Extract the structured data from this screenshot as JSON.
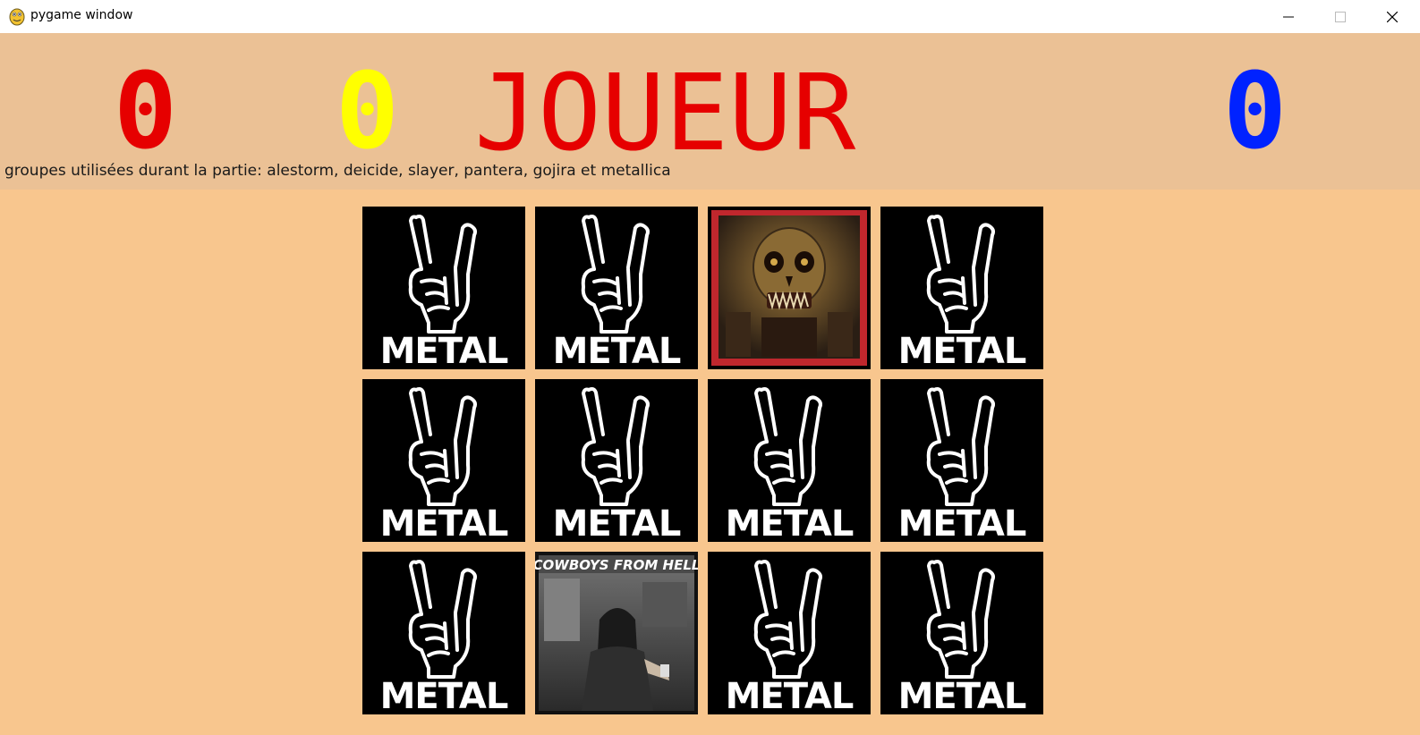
{
  "window": {
    "title": "pygame window",
    "icon": "snake-icon",
    "controls": [
      "minimize-icon",
      "maximize-icon",
      "close-icon"
    ]
  },
  "header": {
    "scores": [
      {
        "player": "red",
        "value": "0",
        "color": "#e60000"
      },
      {
        "player": "yellow",
        "value": "0",
        "color": "#ffff00"
      },
      {
        "player": "blue",
        "value": "0",
        "color": "#0022ff"
      }
    ],
    "current_player_label": "JOUEUR",
    "current_player_color": "#e60000",
    "bands_info": "groupes utilisées durant la partie: alestorm, deicide, slayer, pantera, gojira et metallica"
  },
  "board": {
    "rows": 3,
    "cols": 4,
    "card_back_text": "METAL",
    "card_back_icon": "devil-horns-hand-icon",
    "cards": [
      {
        "state": "hidden"
      },
      {
        "state": "hidden"
      },
      {
        "state": "revealed",
        "art": "slayer-seasons-in-the-abyss",
        "border_color": "#c0272d"
      },
      {
        "state": "hidden"
      },
      {
        "state": "hidden"
      },
      {
        "state": "hidden"
      },
      {
        "state": "hidden"
      },
      {
        "state": "hidden"
      },
      {
        "state": "hidden"
      },
      {
        "state": "revealed",
        "art": "pantera-cowboys-from-hell",
        "caption": "COWBOYS FROM HELL"
      },
      {
        "state": "hidden"
      },
      {
        "state": "hidden"
      }
    ]
  }
}
